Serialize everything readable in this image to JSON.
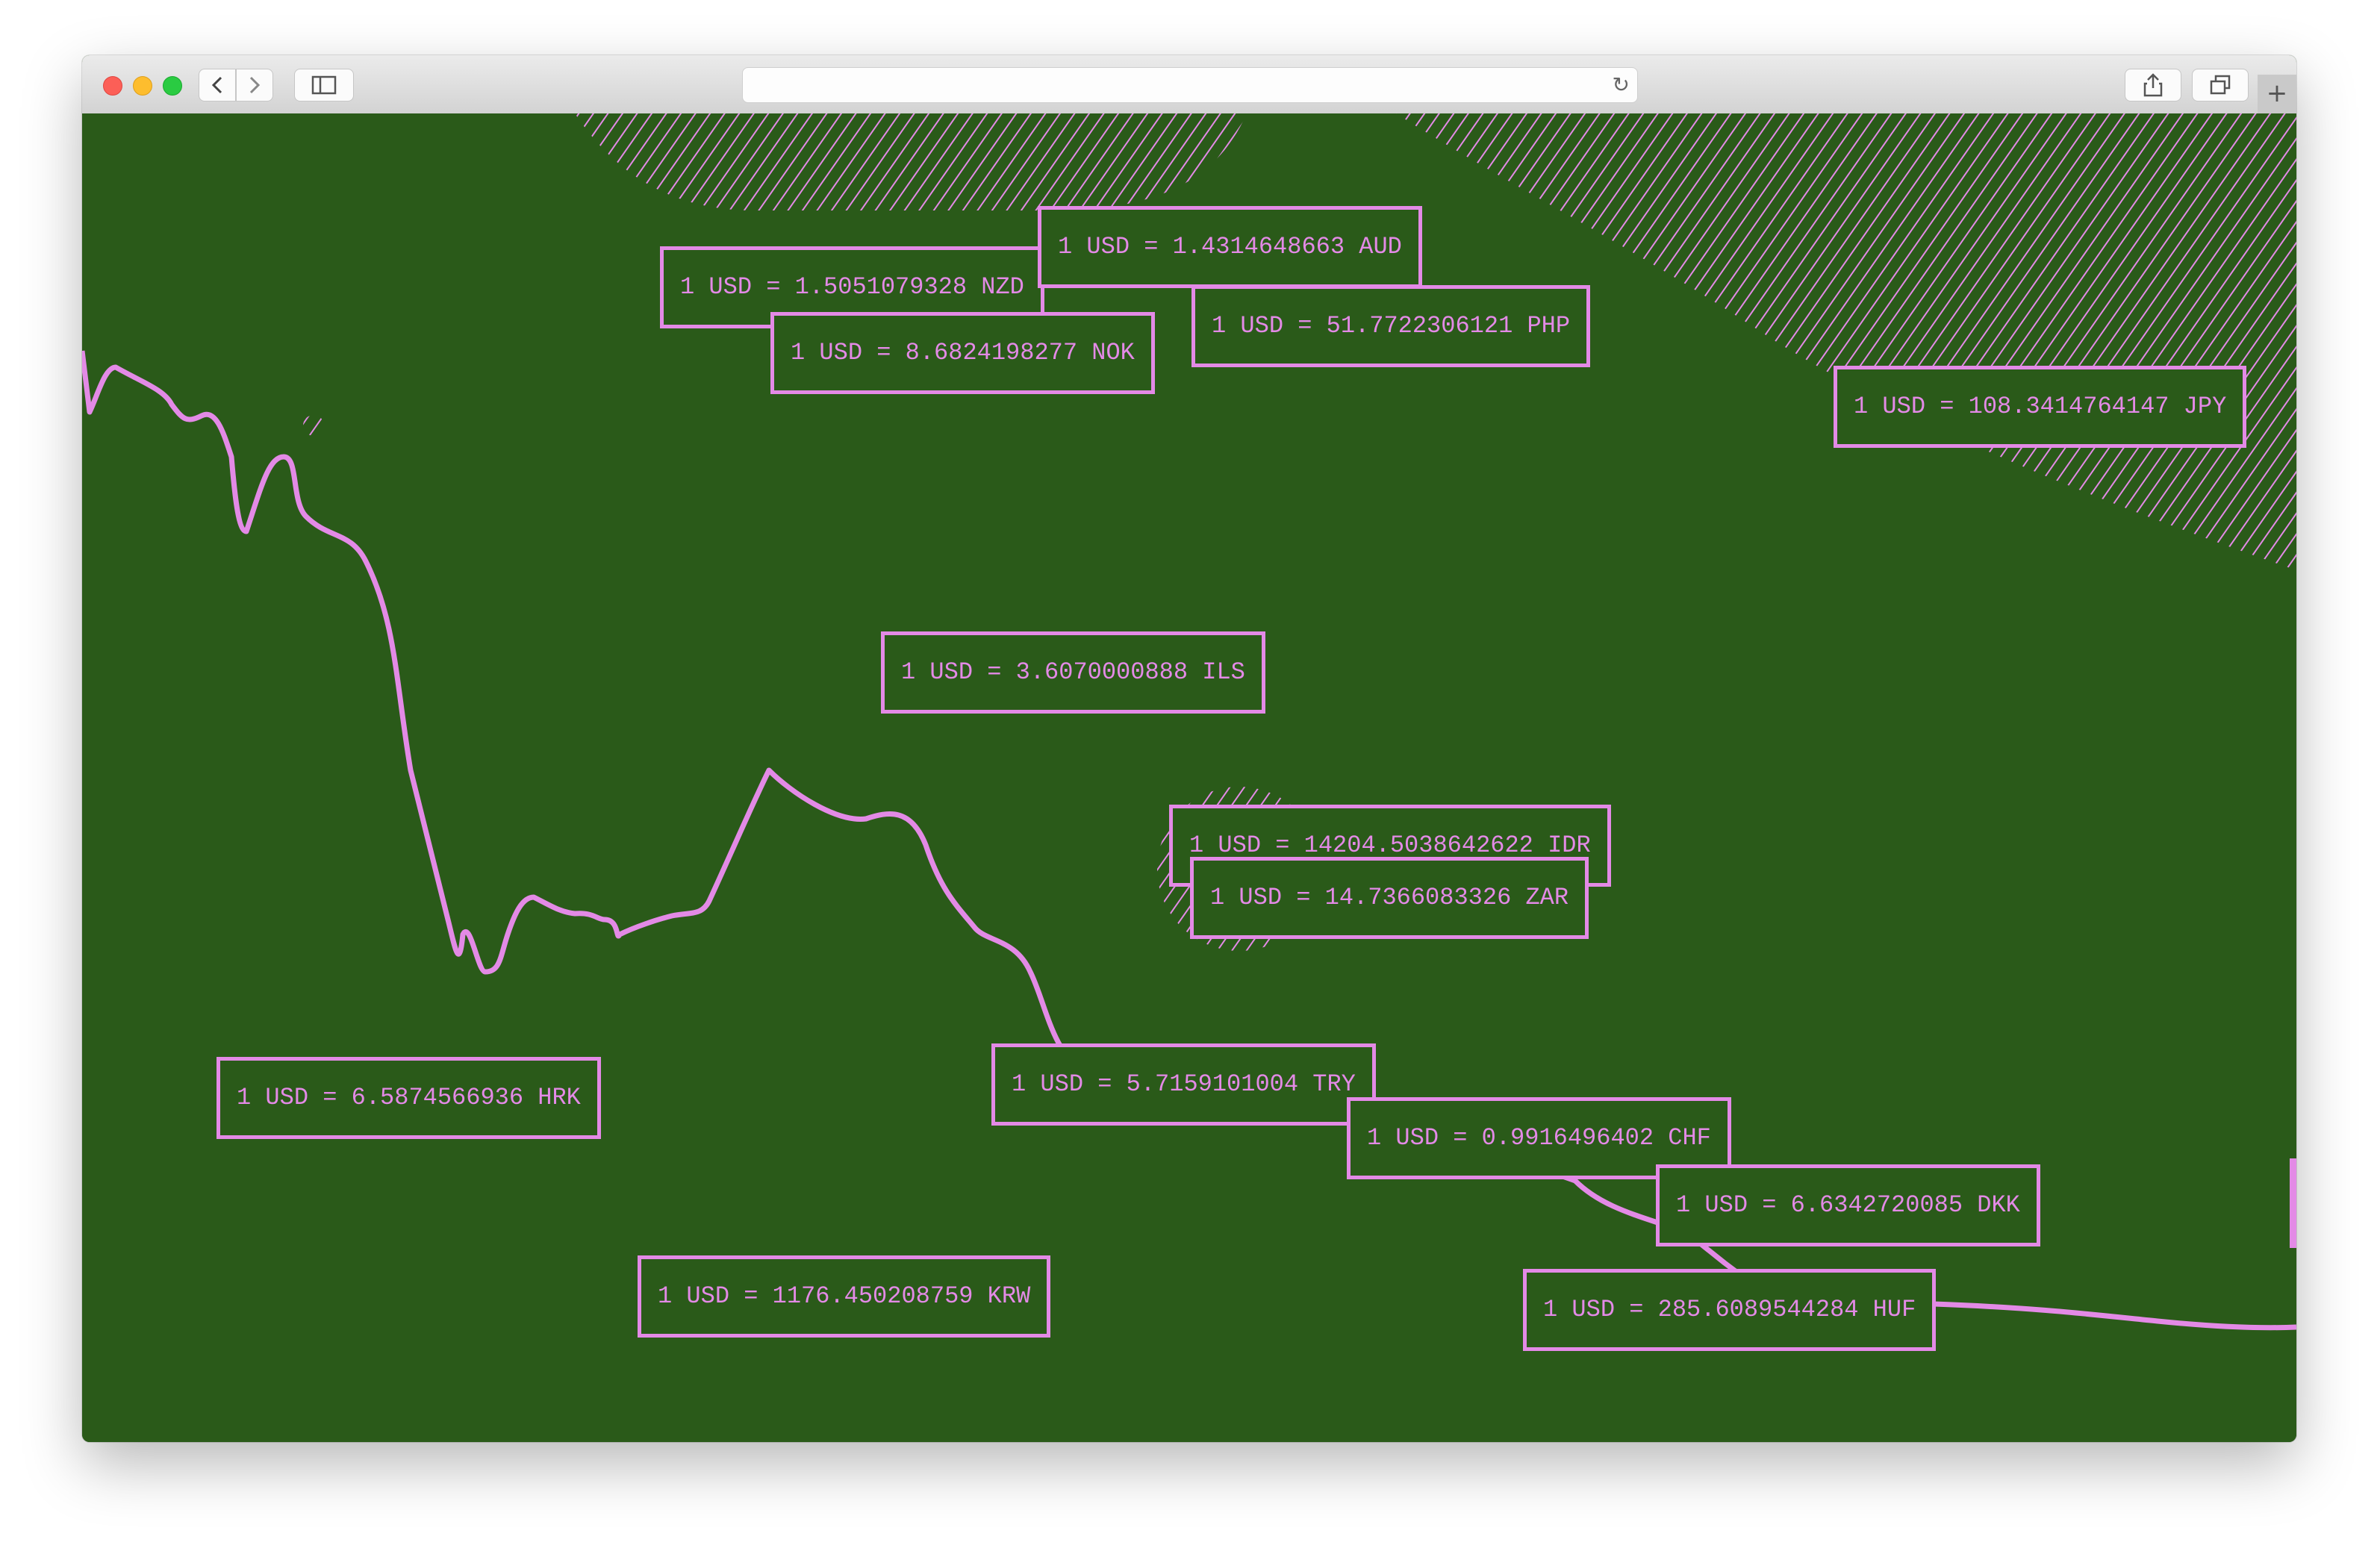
{
  "browser": {
    "address_text": "",
    "icons": [
      "close-icon",
      "minimize-icon",
      "maximize-icon",
      "back-icon",
      "forward-icon",
      "sidebar-icon",
      "reload-icon",
      "share-icon",
      "tabs-icon",
      "new-tab-icon"
    ]
  },
  "colors": {
    "background": "#2a5a19",
    "accent": "#e38ae6"
  },
  "rates": [
    {
      "text": "1 USD = 1.5051079328 NZD"
    },
    {
      "text": "1 USD = 1.4314648663 AUD"
    },
    {
      "text": "1 USD = 8.6824198277 NOK"
    },
    {
      "text": "1 USD = 51.7722306121 PHP"
    },
    {
      "text": "1 USD = 108.3414764147 JPY"
    },
    {
      "text": "1 USD = 3.6070000888 ILS"
    },
    {
      "text": "1 USD = 14204.5038642622 IDR"
    },
    {
      "text": "1 USD = 14.7366083326 ZAR"
    },
    {
      "text": "1 USD = 6.5874566936 HRK"
    },
    {
      "text": "1 USD = 5.7159101004 TRY"
    },
    {
      "text": "1 USD = 0.9916496402 CHF"
    },
    {
      "text": "1 USD = 6.6342720085 DKK"
    },
    {
      "text": "1 USD = 1176.450208759 KRW"
    },
    {
      "text": "1 USD = 285.6089544284 HUF"
    }
  ]
}
